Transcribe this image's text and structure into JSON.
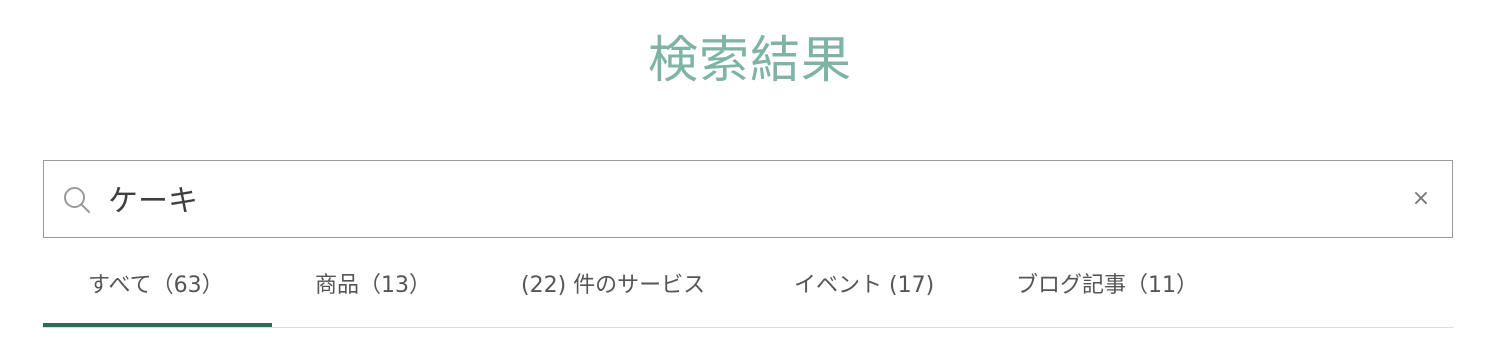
{
  "page": {
    "title": "検索結果"
  },
  "search": {
    "value": "ケーキ",
    "clear_label": "×",
    "icon": "search-icon"
  },
  "tabs": [
    {
      "label": "すべて（63）",
      "selected": true
    },
    {
      "label": "商品（13）",
      "selected": false
    },
    {
      "label": "(22) 件のサービス",
      "selected": false
    },
    {
      "label": "イベント (17)",
      "selected": false
    },
    {
      "label": "ブログ記事（11）",
      "selected": false
    }
  ],
  "colors": {
    "title": "#7fb3a5",
    "active_tab_indicator": "#2f6a58",
    "border": "#9a9a9a"
  }
}
